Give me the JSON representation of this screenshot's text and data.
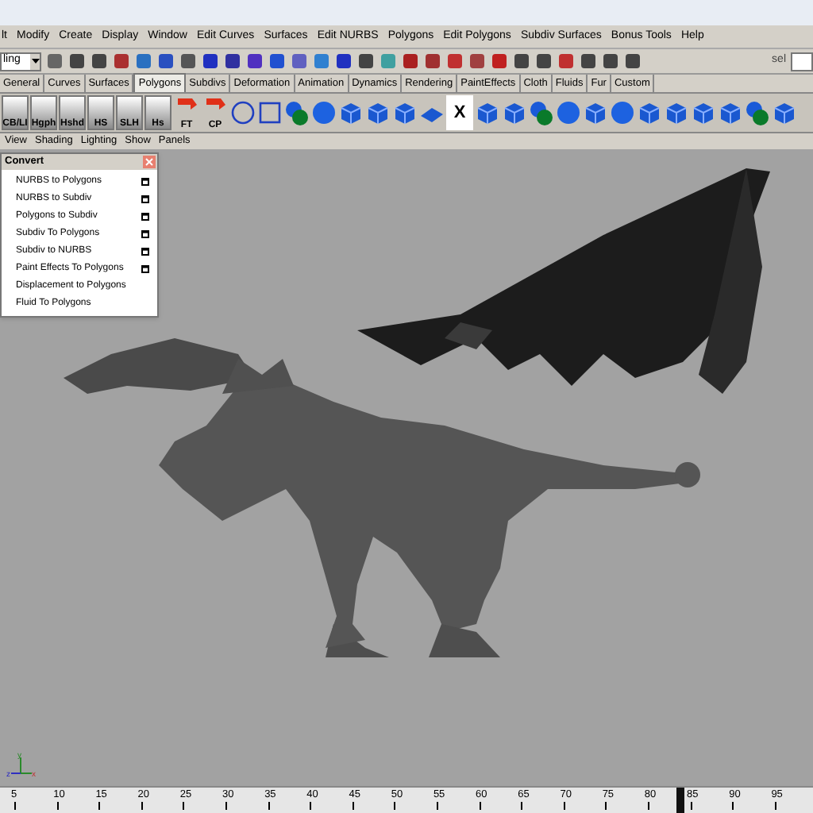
{
  "menubar": [
    "lt",
    "Modify",
    "Create",
    "Display",
    "Window",
    "Edit Curves",
    "Surfaces",
    "Edit NURBS",
    "Polygons",
    "Edit Polygons",
    "Subdiv Surfaces",
    "Bonus Tools",
    "Help"
  ],
  "status_line": {
    "menu_set": "ling",
    "selection_field": "sel"
  },
  "shelf_tabs": [
    {
      "label": "General",
      "selected": false
    },
    {
      "label": "Curves",
      "selected": false
    },
    {
      "label": "Surfaces",
      "selected": false
    },
    {
      "label": "Polygons",
      "selected": true
    },
    {
      "label": "Subdivs",
      "selected": false
    },
    {
      "label": "Deformation",
      "selected": false
    },
    {
      "label": "Animation",
      "selected": false
    },
    {
      "label": "Dynamics",
      "selected": false
    },
    {
      "label": "Rendering",
      "selected": false
    },
    {
      "label": "PaintEffects",
      "selected": false
    },
    {
      "label": "Cloth",
      "selected": false
    },
    {
      "label": "Fluids",
      "selected": false
    },
    {
      "label": "Fur",
      "selected": false
    },
    {
      "label": "Custom",
      "selected": false
    }
  ],
  "shelf": [
    {
      "kind": "label",
      "label": "CB/LI"
    },
    {
      "kind": "label",
      "label": "Hgph"
    },
    {
      "kind": "label",
      "label": "Hshd"
    },
    {
      "kind": "label",
      "label": "HS"
    },
    {
      "kind": "label",
      "label": "SLH"
    },
    {
      "kind": "label",
      "label": "Hs"
    },
    {
      "kind": "arrow",
      "label": "FT"
    },
    {
      "kind": "arrow",
      "label": "CP"
    },
    {
      "kind": "circle"
    },
    {
      "kind": "square"
    },
    {
      "kind": "spheres"
    },
    {
      "kind": "sphere"
    },
    {
      "kind": "cube"
    },
    {
      "kind": "cube"
    },
    {
      "kind": "cube"
    },
    {
      "kind": "plane"
    },
    {
      "kind": "text",
      "label": "X"
    },
    {
      "kind": "cube"
    },
    {
      "kind": "cube"
    },
    {
      "kind": "spheres"
    },
    {
      "kind": "sphere"
    },
    {
      "kind": "cube"
    },
    {
      "kind": "sphere"
    },
    {
      "kind": "cube"
    },
    {
      "kind": "cube"
    },
    {
      "kind": "cube"
    },
    {
      "kind": "cube"
    },
    {
      "kind": "spheres"
    },
    {
      "kind": "cube"
    }
  ],
  "panel_menu": [
    "View",
    "Shading",
    "Lighting",
    "Show",
    "Panels"
  ],
  "convert_window": {
    "title": "Convert",
    "items": [
      {
        "label": "NURBS to Polygons",
        "option_box": true
      },
      {
        "label": "NURBS to Subdiv",
        "option_box": true
      },
      {
        "label": "Polygons to Subdiv",
        "option_box": true
      },
      {
        "label": "Subdiv To Polygons",
        "option_box": true
      },
      {
        "label": "Subdiv to NURBS",
        "option_box": true
      },
      {
        "label": "Paint Effects To Polygons",
        "option_box": true
      },
      {
        "label": "Displacement to Polygons",
        "option_box": false
      },
      {
        "label": "Fluid To Polygons",
        "option_box": false
      }
    ]
  },
  "axis_labels": [
    "y",
    "z",
    "x"
  ],
  "timeline": {
    "ticks": [
      "5",
      "10",
      "15",
      "20",
      "25",
      "30",
      "35",
      "40",
      "45",
      "50",
      "55",
      "60",
      "65",
      "70",
      "75",
      "80",
      "85",
      "90",
      "95"
    ],
    "level": 0.87
  }
}
